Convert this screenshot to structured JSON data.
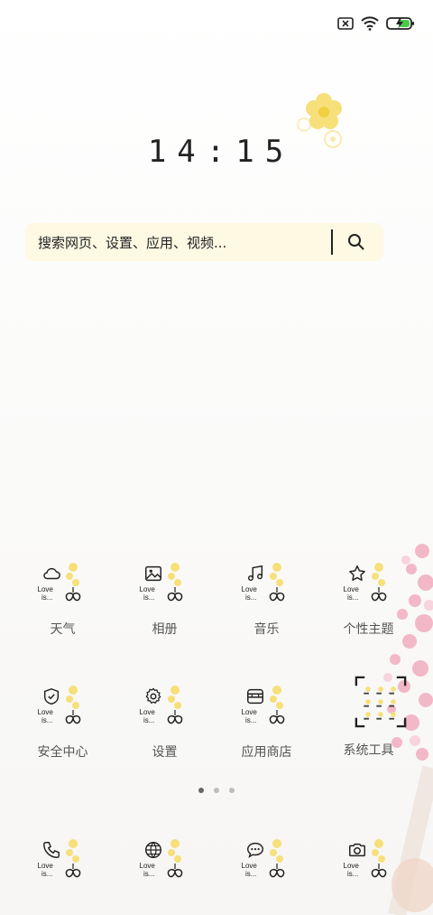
{
  "clock": {
    "time": "14:15"
  },
  "search": {
    "placeholder": "搜索网页、设置、应用、视频..."
  },
  "apps_row1": [
    {
      "label": "天气",
      "love": "Love\nis...",
      "icon": "cloud-icon"
    },
    {
      "label": "相册",
      "love": "Love\nis...",
      "icon": "image-icon"
    },
    {
      "label": "音乐",
      "love": "Love\nis...",
      "icon": "music-note-icon"
    },
    {
      "label": "个性主题",
      "love": "Love\nis...",
      "icon": "star-icon"
    }
  ],
  "apps_row2": [
    {
      "label": "安全中心",
      "love": "Love\nis...",
      "icon": "shield-icon"
    },
    {
      "label": "设置",
      "love": "Love\nis...",
      "icon": "gear-icon"
    },
    {
      "label": "应用商店",
      "love": "Love\nis...",
      "icon": "store-icon"
    },
    {
      "label": "系统工具",
      "icon": "folder-icon"
    }
  ],
  "dock": [
    {
      "love": "Love\nis...",
      "icon": "phone-icon"
    },
    {
      "love": "Love\nis...",
      "icon": "globe-icon"
    },
    {
      "love": "Love\nis...",
      "icon": "chat-icon"
    },
    {
      "love": "Love\nis...",
      "icon": "camera-icon"
    }
  ],
  "pager": {
    "pages": 3,
    "active": 1
  },
  "colors": {
    "search_bg": "#fdf9e3",
    "flower": "#f7e07a",
    "blossom": "#f2b8c8"
  }
}
